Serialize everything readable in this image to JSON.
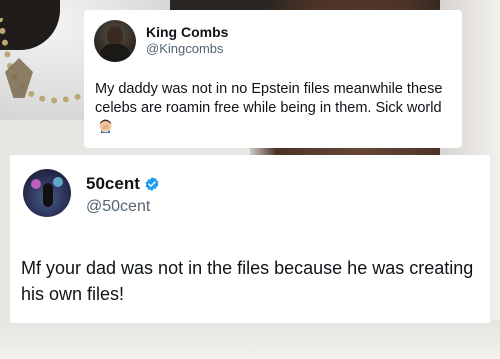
{
  "tweet1": {
    "display_name": "King Combs",
    "handle": "@Kingcombs",
    "text": "My daddy was not in no Epstein files meanwhile these celebs are roamin free while being in them. Sick world",
    "emoji_icon": "man-facepalming-emoji"
  },
  "tweet2": {
    "display_name": "50cent",
    "handle": "@50cent",
    "verified": true,
    "verified_color": "#1d9bf0",
    "text": "Mf your dad was not in the files because he was creating his own files!"
  }
}
